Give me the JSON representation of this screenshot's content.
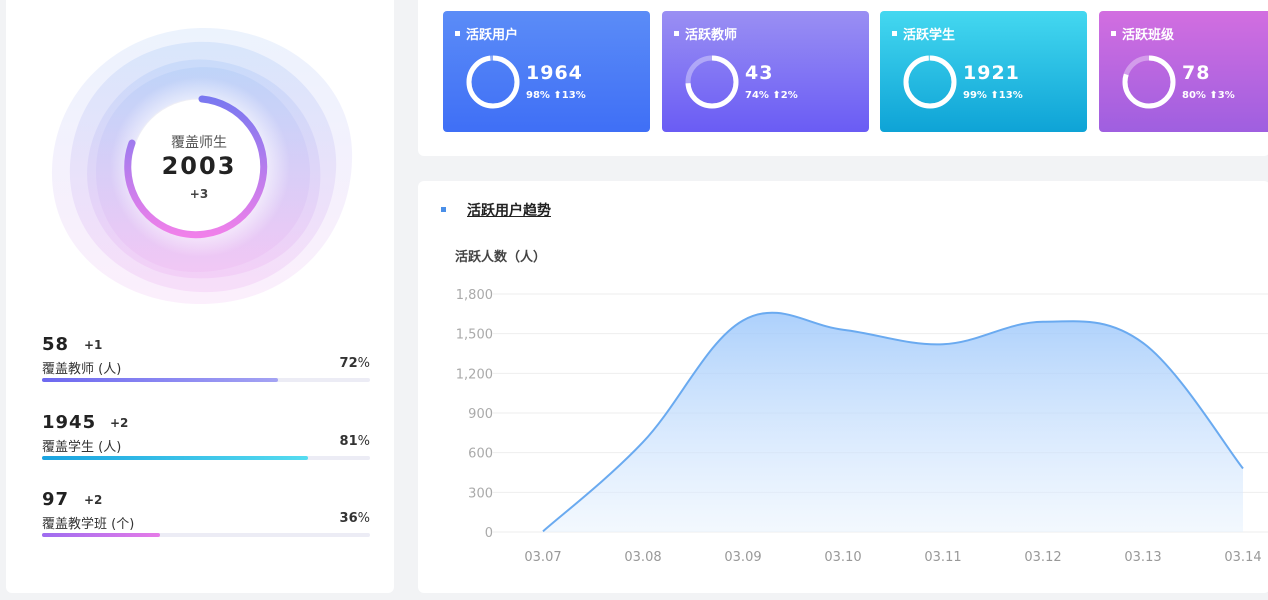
{
  "coverage": {
    "label": "覆盖师生",
    "value": "2003",
    "delta": "+3"
  },
  "stats": [
    {
      "number": "58",
      "delta": "+1",
      "label": "覆盖教师 (人)",
      "percent_num": "72",
      "percent_sign": "%",
      "progress": 0.72,
      "color_start": "#6d68f0",
      "color_end": "#a4a3f3"
    },
    {
      "number": "1945",
      "delta": "+2",
      "label": "覆盖学生 (人)",
      "percent_num": "81",
      "percent_sign": "%",
      "progress": 0.81,
      "color_start": "#1aa3e0",
      "color_end": "#55dcf0"
    },
    {
      "number": "97",
      "delta": "+2",
      "label": "覆盖教学班 (个)",
      "percent_num": "36",
      "percent_sign": "%",
      "progress": 0.36,
      "color_start": "#9e6cf0",
      "color_end": "#e67be8"
    }
  ],
  "tiles": [
    {
      "title": "活跃用户",
      "value": "1964",
      "sub": "98% ⬆13%",
      "ring_progress": 0.98,
      "color_top": "#5b8cf7",
      "color_bottom": "#3f6ff6"
    },
    {
      "title": "活跃教师",
      "value": "43",
      "sub": "74% ⬆2%",
      "ring_progress": 0.74,
      "color_top": "#9a8ff3",
      "color_bottom": "#6a5cf4"
    },
    {
      "title": "活跃学生",
      "value": "1921",
      "sub": "99% ⬆13%",
      "ring_progress": 0.99,
      "color_top": "#44d8f0",
      "color_bottom": "#0ea3d6"
    },
    {
      "title": "活跃班级",
      "value": "78",
      "sub": "80% ⬆3%",
      "ring_progress": 0.8,
      "color_top": "#d26ee0",
      "color_bottom": "#9f5fe0"
    }
  ],
  "trend": {
    "title": "活跃用户趋势",
    "y_title": "活跃人数（人）"
  },
  "chart_data": {
    "type": "area",
    "x": [
      "03.07",
      "03.08",
      "03.09",
      "03.10",
      "03.11",
      "03.12",
      "03.13",
      "03.14"
    ],
    "series": [
      {
        "values": [
          5,
          680,
          1600,
          1530,
          1420,
          1590,
          1430,
          480
        ]
      }
    ],
    "y_ticks": [
      "1,800",
      "1,500",
      "1,200",
      "900",
      "600",
      "300",
      "0"
    ],
    "ylim": [
      0,
      1800
    ],
    "line_color": "#6aaaf0",
    "grid": true
  }
}
